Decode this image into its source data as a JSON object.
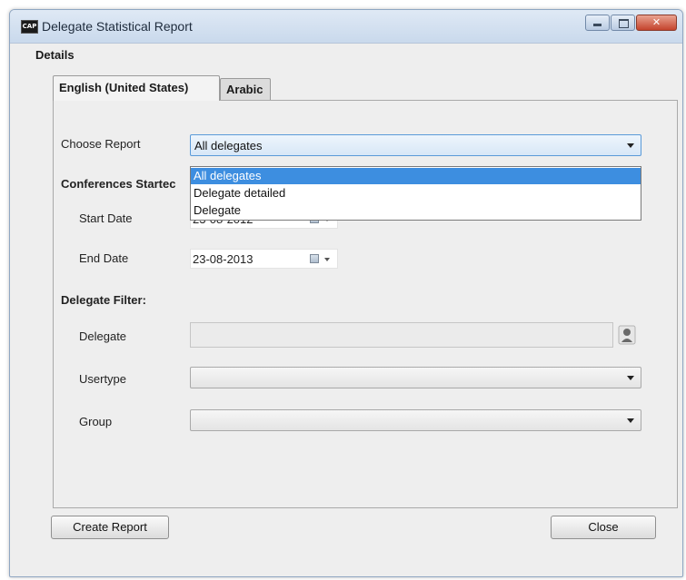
{
  "window": {
    "title": "Delegate Statistical Report",
    "app_icon_text": "CAP"
  },
  "details_label": "Details",
  "tabs": [
    {
      "label": "English (United States)",
      "active": true
    },
    {
      "label": "Arabic",
      "active": false
    }
  ],
  "form": {
    "choose_report_label": "Choose Report",
    "choose_report_value": "All delegates",
    "report_options": [
      "All delegates",
      "Delegate detailed",
      "Delegate"
    ],
    "conferences_started_label": "Conferences Startec",
    "start_date_label": "Start Date",
    "start_date_value": "23-08-2012",
    "end_date_label": "End Date",
    "end_date_value": "23-08-2013",
    "delegate_filter_label": "Delegate Filter:",
    "delegate_label": "Delegate",
    "delegate_value": "",
    "usertype_label": "Usertype",
    "usertype_value": "",
    "group_label": "Group",
    "group_value": ""
  },
  "buttons": {
    "create_report": "Create Report",
    "close": "Close"
  },
  "colors": {
    "selection": "#3d8ee0",
    "focus_border": "#5a9ad8",
    "titlebar": "#c9d9ec",
    "close_button": "#c4432c"
  },
  "icons": {
    "calendar": "calendar-icon",
    "lookup": "person-lookup-icon"
  }
}
